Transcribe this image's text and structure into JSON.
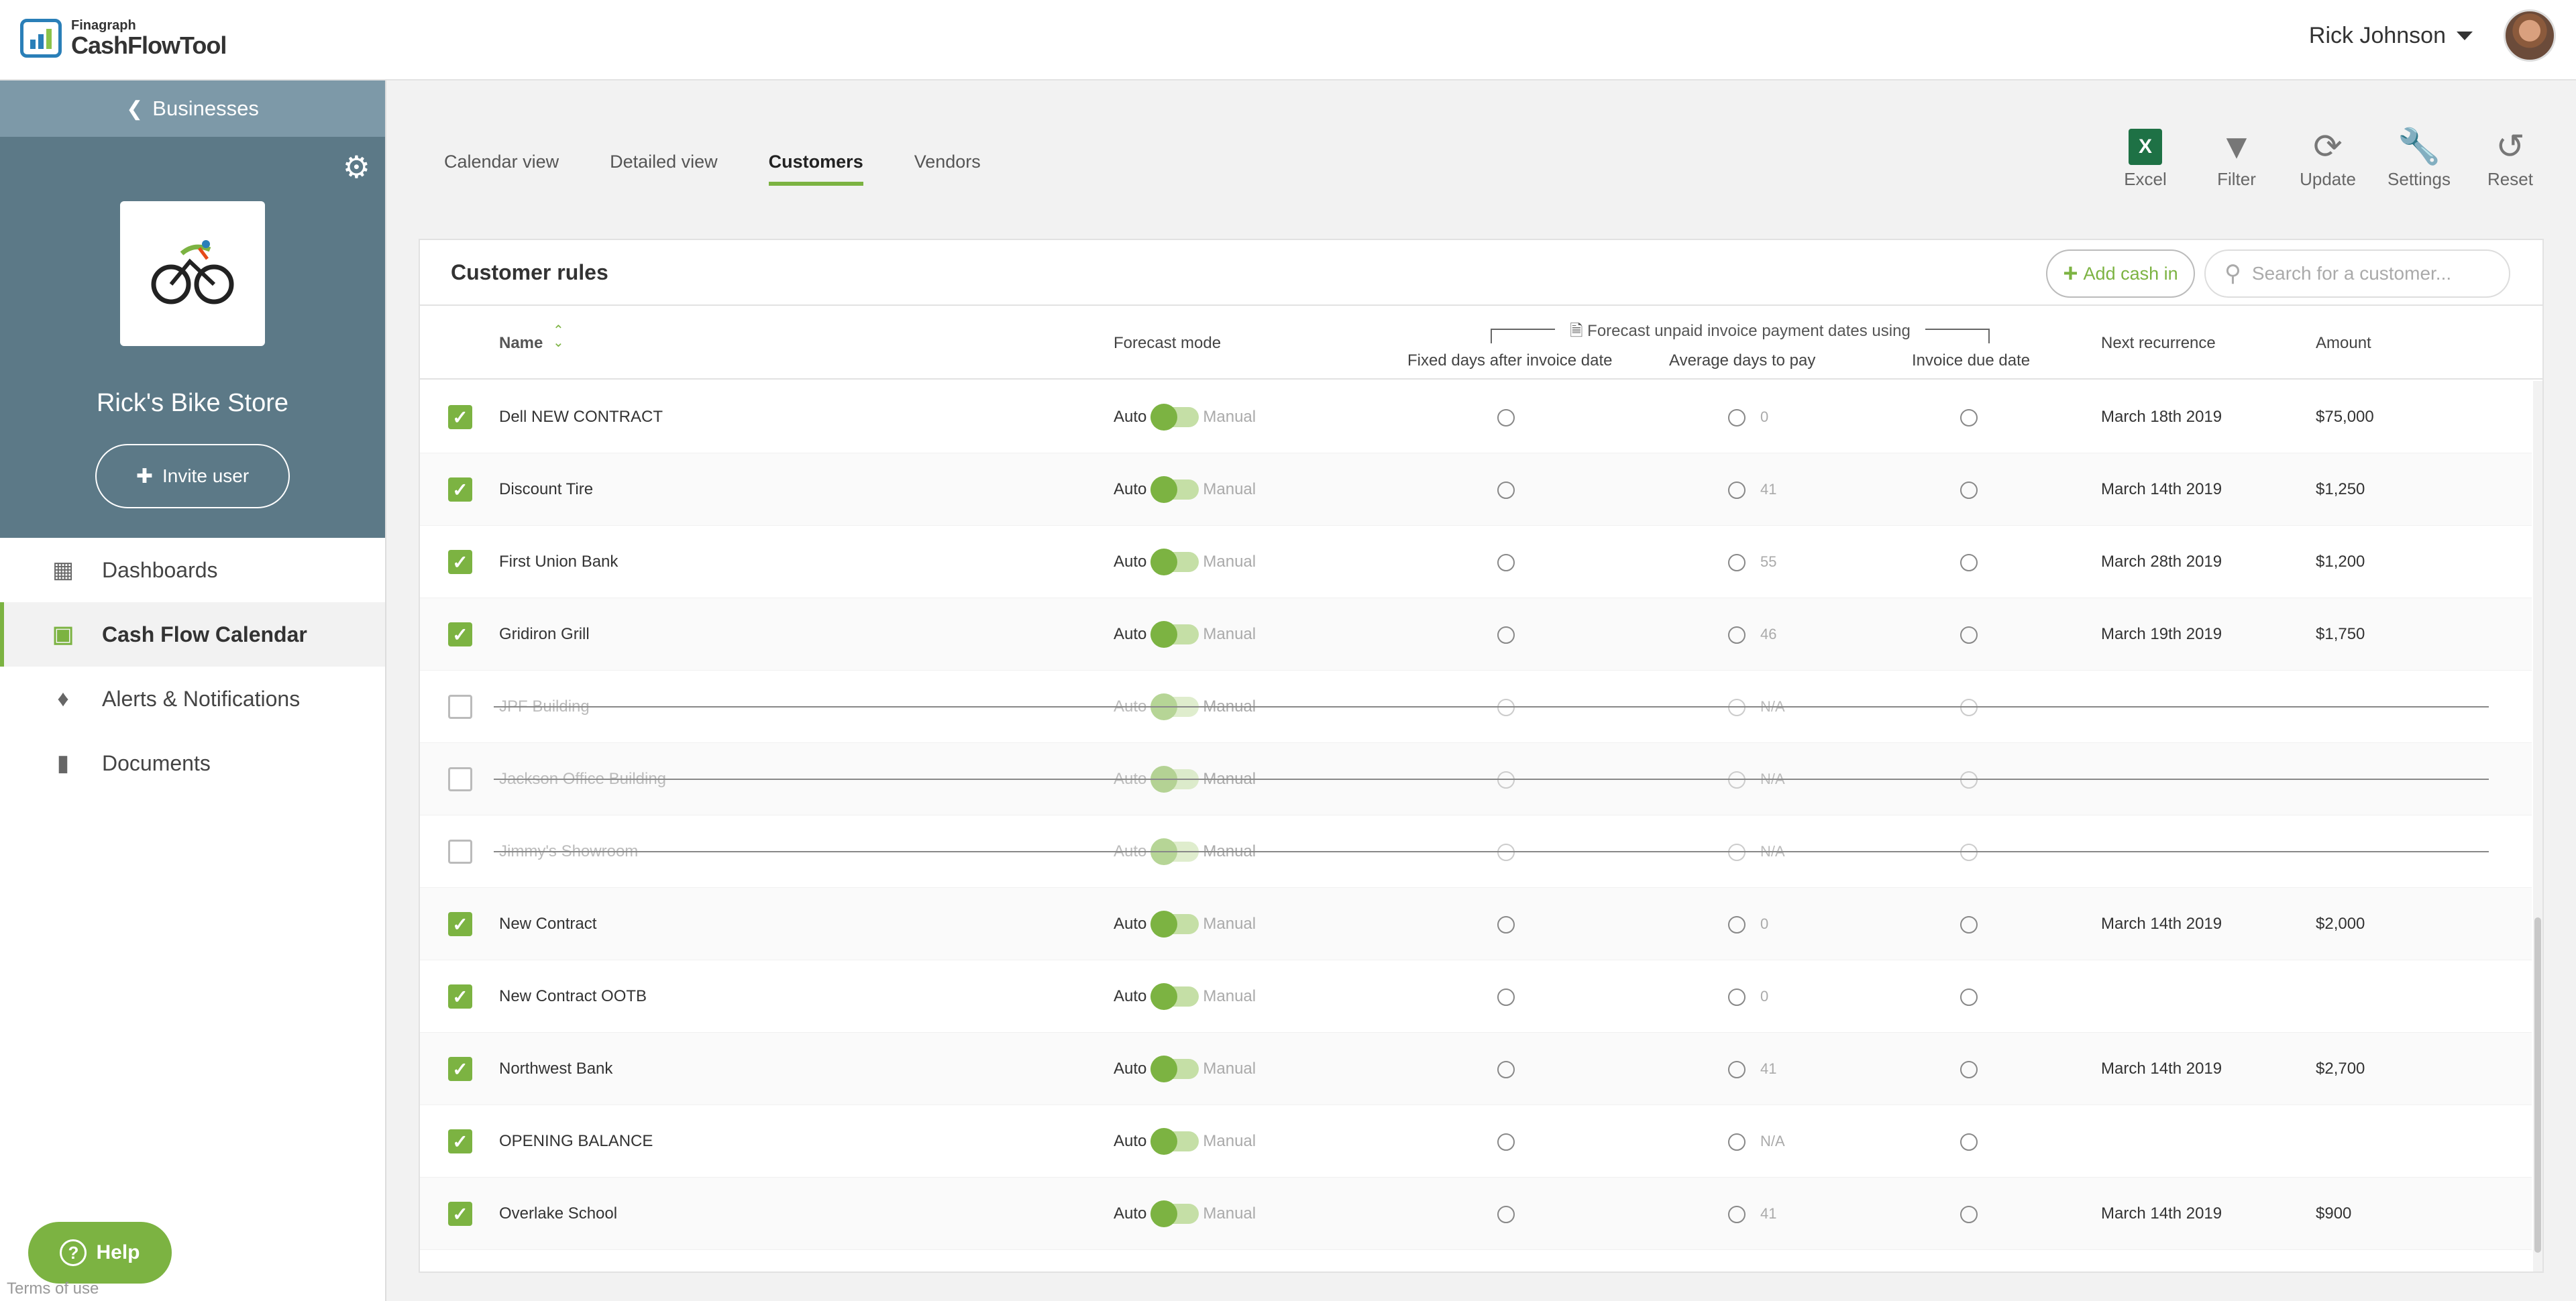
{
  "app": {
    "brand_small": "Finagraph",
    "brand_name": "CashFlowTool"
  },
  "user": {
    "name": "Rick Johnson"
  },
  "sidebar": {
    "back_label": "Businesses",
    "business_name": "Rick's Bike Store",
    "invite_label": "Invite user",
    "nav": [
      {
        "label": "Dashboards",
        "icon": "dashboard-icon"
      },
      {
        "label": "Cash Flow Calendar",
        "icon": "calendar-icon"
      },
      {
        "label": "Alerts & Notifications",
        "icon": "bell-icon"
      },
      {
        "label": "Documents",
        "icon": "document-icon"
      }
    ],
    "help_label": "Help",
    "terms_label": "Terms of use"
  },
  "tabs": [
    "Calendar view",
    "Detailed view",
    "Customers",
    "Vendors"
  ],
  "toolbar": [
    "Excel",
    "Filter",
    "Update",
    "Settings",
    "Reset"
  ],
  "card": {
    "title": "Customer rules",
    "add_cash_label": "Add cash in",
    "search_placeholder": "Search for a customer..."
  },
  "columns": {
    "name": "Name",
    "mode": "Forecast mode",
    "group": "Forecast unpaid invoice payment dates using",
    "fixed": "Fixed days after invoice date",
    "avg": "Average days to pay",
    "due": "Invoice due date",
    "next": "Next recurrence",
    "amount": "Amount"
  },
  "mode_labels": {
    "auto": "Auto",
    "manual": "Manual"
  },
  "rows": [
    {
      "name": "Dell NEW CONTRACT",
      "checked": true,
      "avg": "0",
      "next": "March 18th 2019",
      "amount": "$75,000"
    },
    {
      "name": "Discount Tire",
      "checked": true,
      "avg": "41",
      "next": "March 14th 2019",
      "amount": "$1,250"
    },
    {
      "name": "First Union Bank",
      "checked": true,
      "avg": "55",
      "next": "March 28th 2019",
      "amount": "$1,200"
    },
    {
      "name": "Gridiron Grill",
      "checked": true,
      "avg": "46",
      "next": "March 19th 2019",
      "amount": "$1,750"
    },
    {
      "name": "JPF Building",
      "checked": false,
      "avg": "N/A",
      "next": "",
      "amount": ""
    },
    {
      "name": "Jackson Office Building",
      "checked": false,
      "avg": "N/A",
      "next": "",
      "amount": ""
    },
    {
      "name": "Jimmy's Showroom",
      "checked": false,
      "avg": "N/A",
      "next": "",
      "amount": ""
    },
    {
      "name": "New Contract",
      "checked": true,
      "avg": "0",
      "next": "March 14th 2019",
      "amount": "$2,000"
    },
    {
      "name": "New Contract OOTB",
      "checked": true,
      "avg": "0",
      "next": "",
      "amount": ""
    },
    {
      "name": "Northwest Bank",
      "checked": true,
      "avg": "41",
      "next": "March 14th 2019",
      "amount": "$2,700"
    },
    {
      "name": "OPENING BALANCE",
      "checked": true,
      "avg": "N/A",
      "next": "",
      "amount": ""
    },
    {
      "name": "Overlake School",
      "checked": true,
      "avg": "41",
      "next": "March 14th 2019",
      "amount": "$900"
    }
  ]
}
